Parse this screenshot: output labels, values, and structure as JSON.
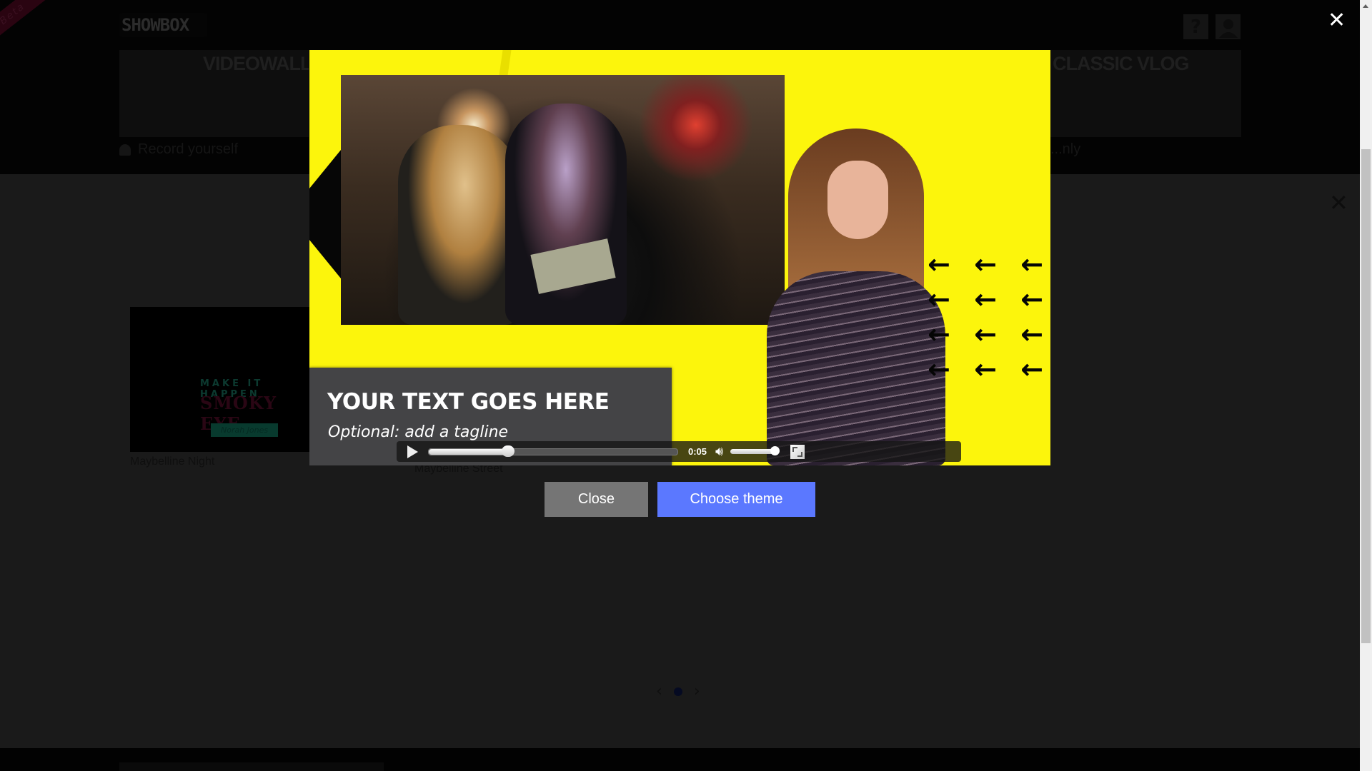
{
  "app": {
    "logo": "SHOWBOX",
    "beta_ribbon": "Beta"
  },
  "header": {
    "help_icon": "question-mark-icon",
    "user_icon": "user-silhouette-icon",
    "categories": [
      {
        "title": "VIDEOWALL",
        "subtitle": "Record yourself"
      },
      {
        "title": "CLASSIC VLOG",
        "subtitle": "...nly"
      }
    ]
  },
  "theme_panel": {
    "close_icon": "close-x-icon",
    "cards": [
      {
        "label": "Maybelline Night",
        "overlay_line1": "MAKE IT HAPPEN",
        "overlay_line2": "SMOKY EYE",
        "overlay_tag": "Norah Jones"
      },
      {
        "label": "Maybelline Street"
      }
    ],
    "pager": {
      "prev": "‹",
      "next": "›",
      "current_page": 1,
      "total_pages": 1
    }
  },
  "preview_modal": {
    "close_icon": "close-x-icon",
    "video": {
      "headline": "YOUR TEXT GOES HERE",
      "tagline": "Optional: add a tagline",
      "arrows": [
        "← ← ←",
        "← ← ←",
        "← ← ←",
        "← ← ←"
      ],
      "controls": {
        "time": "0:05",
        "progress_percent": 32,
        "volume_percent": 95,
        "play_icon": "play-icon",
        "volume_icon": "speaker-volume-icon",
        "fullscreen_icon": "fullscreen-icon"
      }
    },
    "buttons": {
      "close": "Close",
      "choose_theme": "Choose theme"
    }
  },
  "colors": {
    "accent_blue": "#5b78ff",
    "close_grey": "#757575",
    "video_yellow": "#fcf50c"
  }
}
